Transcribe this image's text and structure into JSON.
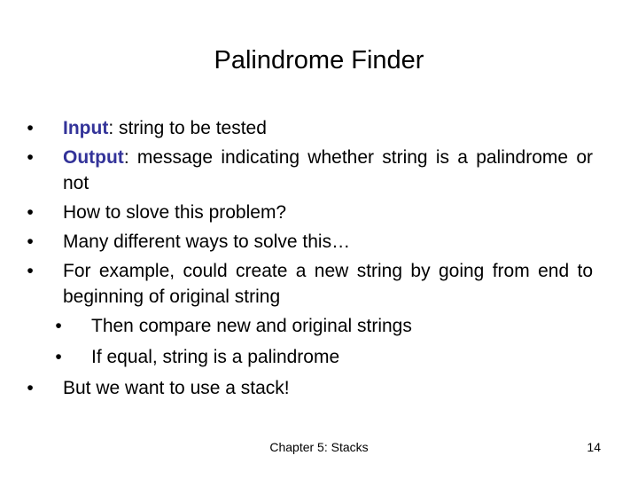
{
  "slide": {
    "title": "Palindrome Finder",
    "accent_color": "#333399",
    "bullets": [
      {
        "level": 1,
        "keyword": "Input",
        "text": ": string to be tested"
      },
      {
        "level": 1,
        "keyword": "Output",
        "text": ": message indicating whether string is a palindrome or not"
      },
      {
        "level": 1,
        "keyword": "",
        "text": "How to slove this problem?"
      },
      {
        "level": 1,
        "keyword": "",
        "text": "Many different ways to solve this…"
      },
      {
        "level": 1,
        "keyword": "",
        "text": "For example, could create a new string by going from end to beginning of original string"
      },
      {
        "level": 2,
        "keyword": "",
        "text": "Then compare new and original strings"
      },
      {
        "level": 2,
        "keyword": "",
        "text": "If equal, string is a palindrome"
      },
      {
        "level": 1,
        "keyword": "",
        "text": "But we want to use a stack!"
      }
    ],
    "bullet_glyph": "•",
    "footer": {
      "center": "Chapter 5: Stacks",
      "page_number": "14"
    }
  }
}
